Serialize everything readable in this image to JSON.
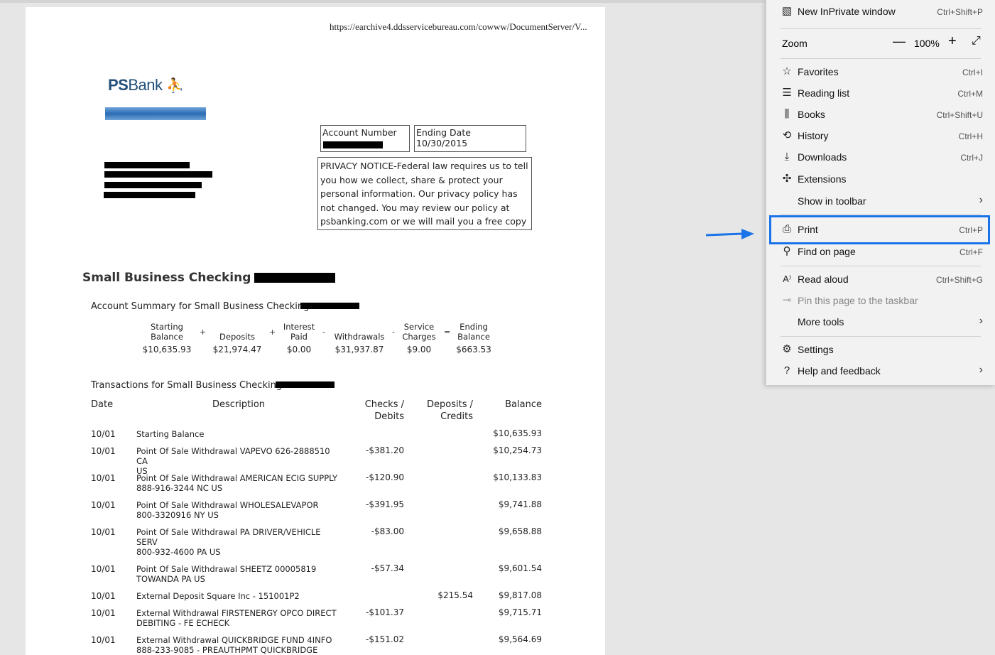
{
  "document": {
    "url": "https://earchive4.ddsservicebureau.com/cowww/DocumentServer/V...",
    "logo_ps": "PS",
    "logo_bank": "Bank",
    "account_number_label": "Account Number",
    "ending_date_label": "Ending Date",
    "ending_date_value": "10/30/2015",
    "privacy_notice": "PRIVACY NOTICE-Federal law requires us to tell you how we collect, share & protect your personal information. Our privacy policy has not changed. You may review our policy at psbanking.com or we will mail you a free copy",
    "section_title": "Small Business Checking -",
    "summary_title": "Account Summary for Small Business Checking -",
    "summary": {
      "columns": [
        {
          "label": "Starting Balance",
          "value": "$10,635.93"
        },
        {
          "label": "Deposits",
          "value": "$21,974.47"
        },
        {
          "label": "Interest Paid",
          "value": "$0.00"
        },
        {
          "label": "Withdrawals",
          "value": "$31,937.87"
        },
        {
          "label": "Service Charges",
          "value": "$9.00"
        },
        {
          "label": "Ending Balance",
          "value": "$663.53"
        }
      ],
      "operators": [
        "+",
        "+",
        "-",
        "-",
        "="
      ]
    },
    "transactions_title": "Transactions for Small Business Checking -",
    "table_headers": {
      "date": "Date",
      "description": "Description",
      "checks_debits": "Checks /\nDebits",
      "deposits_credits": "Deposits /\nCredits",
      "balance": "Balance"
    },
    "transactions": [
      {
        "date": "10/01",
        "description": "Starting Balance",
        "debit": "",
        "credit": "",
        "balance": "$10,635.93"
      },
      {
        "date": "10/01",
        "description": "Point Of Sale Withdrawal VAPEVO 626-2888510 CA\nUS",
        "debit": "-$381.20",
        "credit": "",
        "balance": "$10,254.73"
      },
      {
        "date": "10/01",
        "description": "Point Of Sale Withdrawal AMERICAN ECIG SUPPLY\n888-916-3244 NC US",
        "debit": "-$120.90",
        "credit": "",
        "balance": "$10,133.83"
      },
      {
        "date": "10/01",
        "description": "Point Of Sale Withdrawal WHOLESALEVAPOR\n800-3320916 NY US",
        "debit": "-$391.95",
        "credit": "",
        "balance": "$9,741.88"
      },
      {
        "date": "10/01",
        "description": "Point Of Sale Withdrawal PA DRIVER/VEHICLE\nSERV\n800-932-4600 PA US",
        "debit": "-$83.00",
        "credit": "",
        "balance": "$9,658.88"
      },
      {
        "date": "10/01",
        "description": "Point Of Sale Withdrawal SHEETZ 00005819\nTOWANDA PA US",
        "debit": "-$57.34",
        "credit": "",
        "balance": "$9,601.54"
      },
      {
        "date": "10/01",
        "description": "External Deposit Square Inc - 151001P2",
        "debit": "",
        "credit": "$215.54",
        "balance": "$9,817.08"
      },
      {
        "date": "10/01",
        "description": "External Withdrawal FIRSTENERGY OPCO DIRECT\nDEBITING - FE ECHECK",
        "debit": "-$101.37",
        "credit": "",
        "balance": "$9,715.71"
      },
      {
        "date": "10/01",
        "description": "External Withdrawal QUICKBRIDGE FUND 4INFO\n888-233-9085 - PREAUTHPMT QUICKBRIDGE",
        "debit": "-$151.02",
        "credit": "",
        "balance": "$9,564.69"
      }
    ]
  },
  "menu": {
    "new_inprivate": {
      "label": "New InPrivate window",
      "shortcut": "Ctrl+Shift+P"
    },
    "zoom": {
      "label": "Zoom",
      "minus": "—",
      "value": "100%",
      "plus": "+",
      "fullscreen": "⤢"
    },
    "favorites": {
      "label": "Favorites",
      "shortcut": "Ctrl+I"
    },
    "reading_list": {
      "label": "Reading list",
      "shortcut": "Ctrl+M"
    },
    "books": {
      "label": "Books",
      "shortcut": "Ctrl+Shift+U"
    },
    "history": {
      "label": "History",
      "shortcut": "Ctrl+H"
    },
    "downloads": {
      "label": "Downloads",
      "shortcut": "Ctrl+J"
    },
    "extensions": {
      "label": "Extensions"
    },
    "show_in_toolbar": {
      "label": "Show in toolbar"
    },
    "print": {
      "label": "Print",
      "shortcut": "Ctrl+P"
    },
    "find_on_page": {
      "label": "Find on page",
      "shortcut": "Ctrl+F"
    },
    "read_aloud": {
      "label": "Read aloud",
      "shortcut": "Ctrl+Shift+G"
    },
    "pin_taskbar": {
      "label": "Pin this page to the taskbar"
    },
    "more_tools": {
      "label": "More tools"
    },
    "settings": {
      "label": "Settings"
    },
    "help_feedback": {
      "label": "Help and feedback"
    }
  },
  "colors": {
    "highlight": "#1a73e8",
    "arrow": "#1a73e8",
    "logo": "#24507a"
  }
}
